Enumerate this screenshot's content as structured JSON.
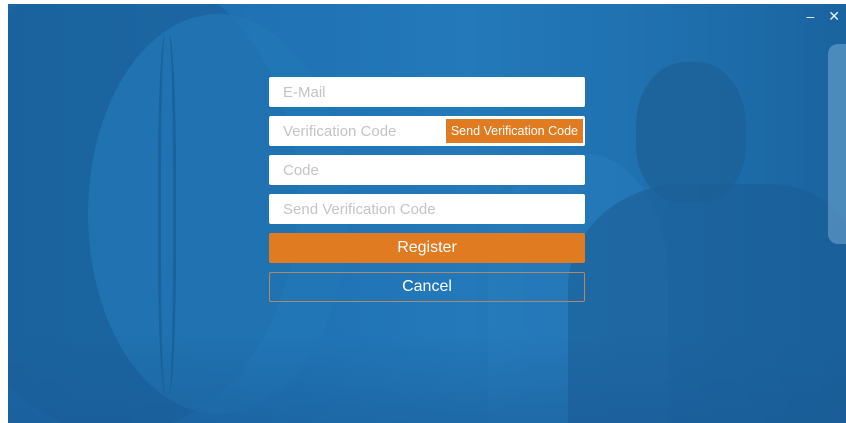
{
  "window": {
    "controls": {
      "minimize": "–",
      "close": "✕"
    }
  },
  "form": {
    "email": {
      "placeholder": "E-Mail",
      "value": ""
    },
    "verification": {
      "placeholder": "Verification Code",
      "value": "",
      "send_button": "Send Verification Code"
    },
    "code": {
      "placeholder": "Code",
      "value": ""
    },
    "confirm": {
      "placeholder": "Send Verification Code",
      "value": ""
    },
    "register_label": "Register",
    "cancel_label": "Cancel"
  },
  "colors": {
    "accent": "#e07b22",
    "background": "#1f72b4",
    "field": "#ffffff"
  }
}
